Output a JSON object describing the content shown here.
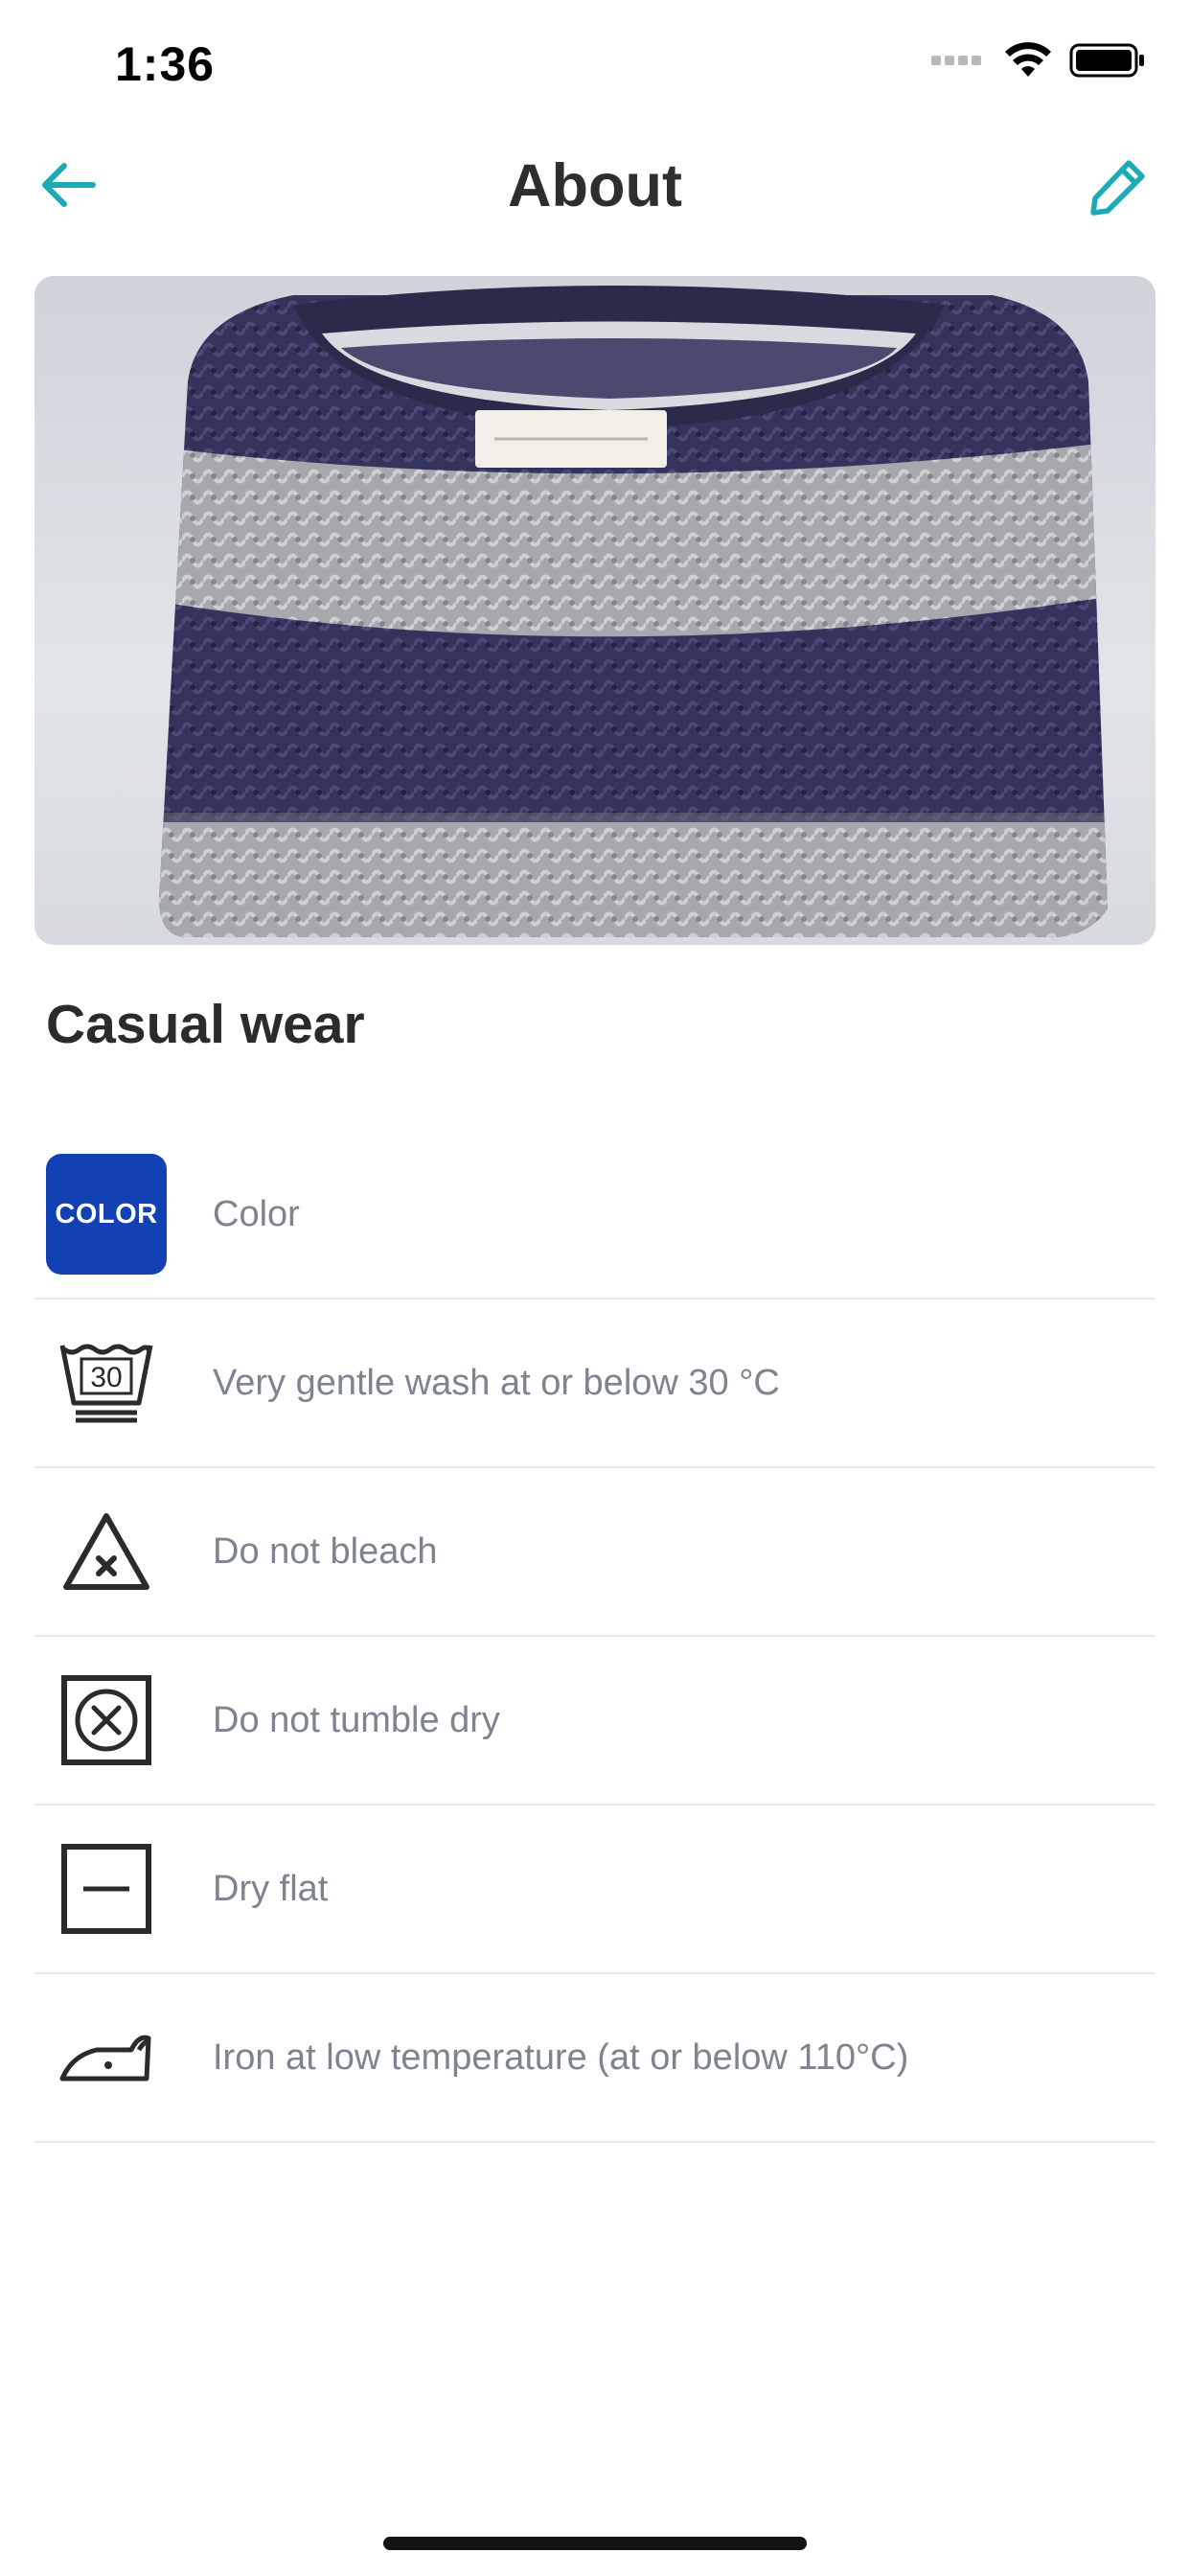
{
  "status_bar": {
    "time": "1:36"
  },
  "nav": {
    "title": "About",
    "back_icon": "arrow-left-icon",
    "edit_icon": "pencil-icon",
    "accent_color": "#1aabb5"
  },
  "item": {
    "title": "Casual wear"
  },
  "care": {
    "color_badge_text": "COLOR",
    "color_badge_color": "#1241b4",
    "wash_temp_label": "30",
    "rows": [
      {
        "icon": "color-badge-icon",
        "label": "Color"
      },
      {
        "icon": "wash-30-icon",
        "label": "Very gentle wash at or below 30 °C"
      },
      {
        "icon": "no-bleach-icon",
        "label": "Do not bleach"
      },
      {
        "icon": "no-tumble-dry-icon",
        "label": "Do not tumble dry"
      },
      {
        "icon": "dry-flat-icon",
        "label": "Dry flat"
      },
      {
        "icon": "iron-low-icon",
        "label": "Iron at low temperature (at or below 110°C)"
      }
    ]
  }
}
